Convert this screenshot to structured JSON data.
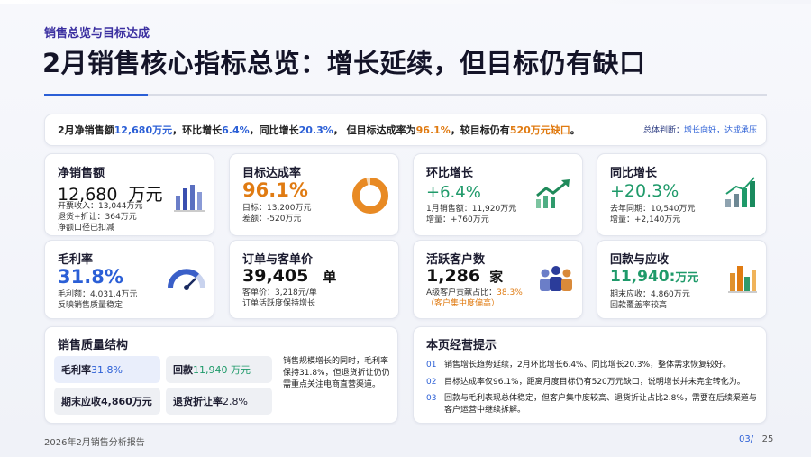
{
  "header": {
    "eyebrow": "销售总览与目标达成",
    "title": "2月销售核心指标总览：增长延续，但目标仍有缺口"
  },
  "summary": {
    "p1": "2月净销售额",
    "v1": "12,680万元",
    "p2": "，环比增长",
    "v2": "6.4%",
    "p3": "，同比增长",
    "v3": "20.3%",
    "p4": "， 但目标达成率为",
    "v4": "96.1%",
    "p5": "，较目标仍有",
    "v5": "520万元缺口",
    "p6": "。",
    "judge_label": "总体判断：",
    "judge_value": "增长向好，达成承压"
  },
  "kpis": {
    "net_sales": {
      "title": "净销售额",
      "value": "12,680",
      "unit": "万元",
      "sub1": "开票收入：13,044万元",
      "sub2": "退货+折让：364万元",
      "sub3": "净额口径已扣减"
    },
    "target_rate": {
      "title": "目标达成率",
      "value": "96.1%",
      "sub1": "目标：13,200万元",
      "sub2": "差额：-520万元",
      "ring_pct": 96.1
    },
    "mom": {
      "title": "环比增长",
      "value": "+6.4%",
      "sub1": "1月销售额：11,920万元",
      "sub2": "增量：+760万元"
    },
    "yoy": {
      "title": "同比增长",
      "value": "+20.3%",
      "sub1": "去年同期：10,540万元",
      "sub2": "增量：+2,140万元"
    },
    "gross_margin": {
      "title": "毛利率",
      "value": "31.8%",
      "sub1": "毛利额：4,031.4万元",
      "sub2": "反映销售质量稳定"
    },
    "orders": {
      "title": "订单与客单价",
      "value": "39,405",
      "unit": "单",
      "sub1": "客单价：3,218元/单",
      "sub2": "订单活跃度保持增长"
    },
    "customers": {
      "title": "活跃客户数",
      "value": "1,286",
      "unit": "家",
      "sub1_a": "A级客户贡献占比：",
      "sub1_b": "38.3%",
      "sub2": "（客户集中度偏高）"
    },
    "collection": {
      "title": "回款与应收",
      "value": "11,940",
      "unit": "万元",
      "sub1": "期末应收：4,860万元",
      "sub2": "回款覆盖率较高"
    }
  },
  "quality": {
    "title": "销售质量结构",
    "pill1_label": "毛利率",
    "pill1_value": "31.8%",
    "pill2_label": "回款",
    "pill2_value": "11,940 万元",
    "pill3_label": "期末应收",
    "pill3_value": "4,860万元",
    "pill4_label": "退货折让率",
    "pill4_value": "2.8%",
    "note": "销售规模增长的同时，毛利率保持31.8%，但退货折让仍仍需重点关注电商直营渠道。"
  },
  "tips": {
    "title": "本页经营提示",
    "items": [
      {
        "num": "01",
        "text": "销售增长趋势延续，2月环比增长6.4%、同比增长20.3%，整体需求恢复较好。"
      },
      {
        "num": "02",
        "text": "目标达成率仅96.1%，距离月度目标仍有520万元缺口，说明增长并未完全转化为。"
      },
      {
        "num": "03",
        "text": "回款与毛利表现总体稳定，但客户集中度较高、退货折让占比2.8%，需要在后续渠道与客户运营中继续拆解。"
      }
    ]
  },
  "footer": {
    "left": "2026年2月销售分析报告",
    "page": "03/",
    "total": "25"
  },
  "colors": {
    "accent": "#2b5fd6",
    "orange": "#e07b12",
    "green": "#1f9a6a",
    "purple": "#3a2fa0"
  }
}
